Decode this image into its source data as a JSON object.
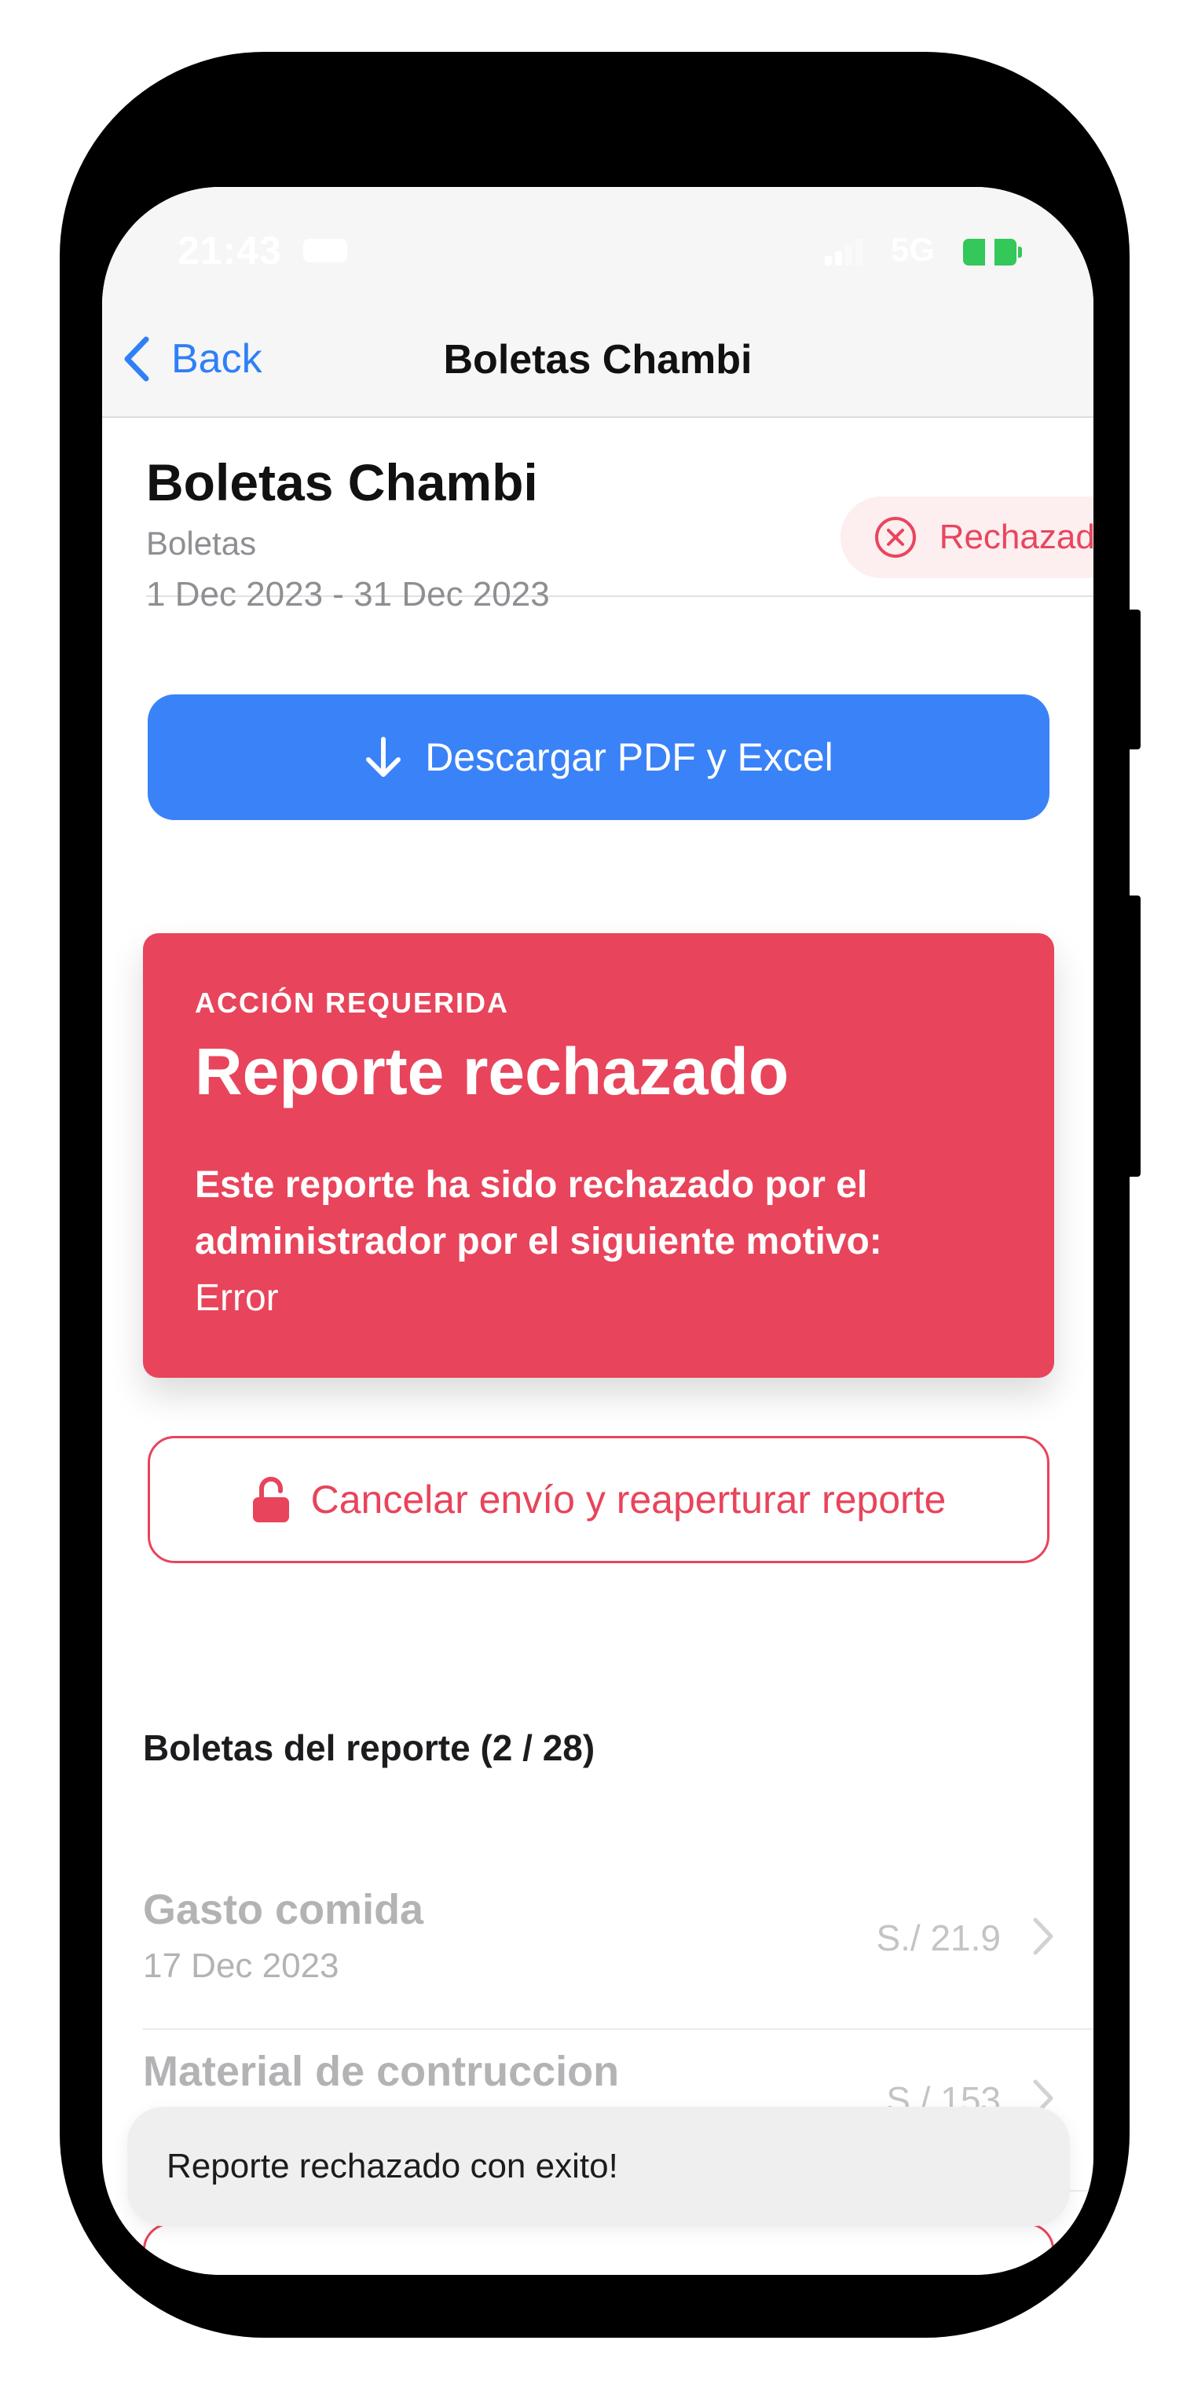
{
  "status_bar": {
    "time": "21:43",
    "network": "5G",
    "icons": [
      "bed-icon",
      "signal-icon",
      "battery-charging-icon"
    ]
  },
  "nav": {
    "back_label": "Back",
    "title": "Boletas Chambi"
  },
  "report": {
    "title": "Boletas Chambi",
    "type": "Boletas",
    "date_range": "1 Dec 2023 - 31 Dec 2023",
    "status": "Rechazado"
  },
  "actions": {
    "download_label": "Descargar PDF y Excel",
    "reopen_label": "Cancelar envío y reaperturar reporte"
  },
  "alert": {
    "eyebrow": "ACCIÓN REQUERIDA",
    "title": "Reporte rechazado",
    "message": "Este reporte ha sido rechazado por el administrador por el siguiente motivo:",
    "reason": "Error"
  },
  "receipts": {
    "heading": "Boletas del reporte (2 / 28)",
    "items": [
      {
        "name": "Gasto comida",
        "date": "17 Dec 2023",
        "amount": "S./ 21.9"
      },
      {
        "name": "Material de contruccion",
        "date": "",
        "amount": "S./ 153"
      }
    ]
  },
  "toast": {
    "message": "Reporte rechazado con exito!"
  },
  "colors": {
    "accent_blue": "#3a82f7",
    "danger_red": "#e8445b",
    "badge_bg": "#fdeef0"
  }
}
